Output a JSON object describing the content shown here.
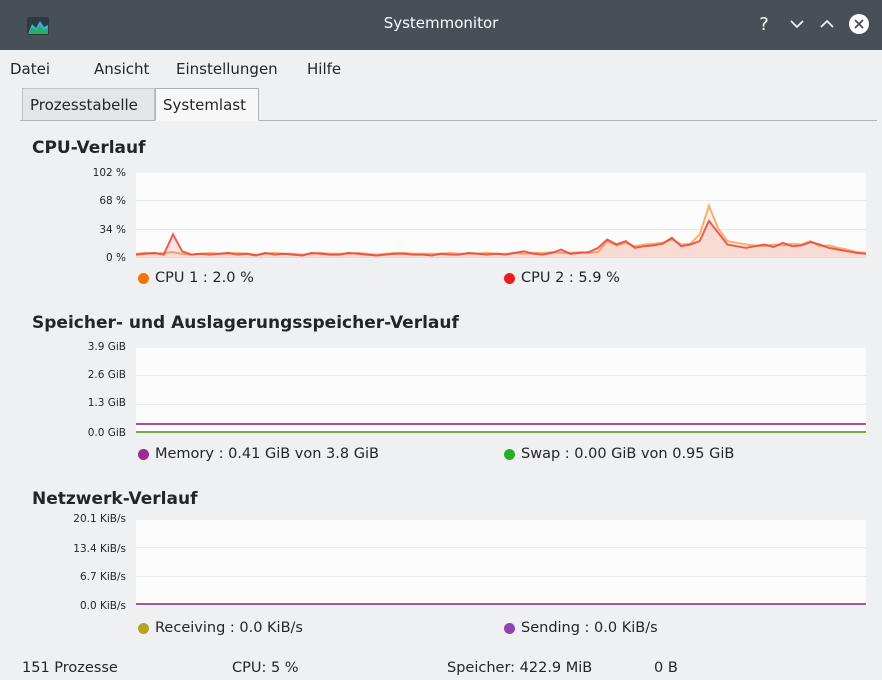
{
  "window": {
    "title": "Systemmonitor",
    "help": "?",
    "icon": "system-monitor-icon"
  },
  "menu": [
    "Datei",
    "Ansicht",
    "Einstellungen",
    "Hilfe"
  ],
  "tabs": [
    {
      "label": "Prozesstabelle",
      "active": false
    },
    {
      "label": "Systemlast",
      "active": true
    }
  ],
  "cpu": {
    "title": "CPU-Verlauf",
    "ticks": [
      "102 %",
      "68 %",
      "34 %",
      "0 %"
    ],
    "legend": [
      {
        "label": "CPU 1 : 2.0 %",
        "color": "#f67400"
      },
      {
        "label": "CPU 2 : 5.9 %",
        "color": "#e91e1e"
      }
    ]
  },
  "memory": {
    "title": "Speicher- und Auslagerungsspeicher-Verlauf",
    "ticks": [
      "3.9 GiB",
      "2.6 GiB",
      "1.3 GiB",
      "0.0 GiB"
    ],
    "legend": [
      {
        "label": "Memory : 0.41 GiB von 3.8 GiB",
        "color": "#9b2e8e"
      },
      {
        "label": "Swap : 0.00 GiB von 0.95 GiB",
        "color": "#27ae27"
      }
    ]
  },
  "network": {
    "title": "Netzwerk-Verlauf",
    "ticks": [
      "20.1 KiB/s",
      "13.4 KiB/s",
      "6.7 KiB/s",
      "0.0 KiB/s"
    ],
    "legend": [
      {
        "label": "Receiving : 0.0 KiB/s",
        "color": "#b6a12d"
      },
      {
        "label": "Sending : 0.0 KiB/s",
        "color": "#8e44ad"
      }
    ]
  },
  "status": {
    "processes": "151 Prozesse",
    "cpu": "CPU: 5 %",
    "memory": "Speicher: 422.9 MiB",
    "swap": "0 B"
  },
  "chart_data": [
    {
      "type": "line",
      "title": "CPU-Verlauf",
      "ylim": [
        0,
        102
      ],
      "series": [
        {
          "name": "CPU 1",
          "values": [
            5,
            6,
            5,
            6,
            7,
            5,
            4,
            5,
            6,
            5,
            5,
            6,
            5,
            4,
            5,
            6,
            5,
            5,
            4,
            5,
            6,
            5,
            5,
            5,
            6,
            5,
            4,
            5,
            6,
            6,
            5,
            5,
            5,
            5,
            6,
            5,
            5,
            5,
            6,
            5,
            5,
            6,
            5,
            6,
            6,
            7,
            6,
            6,
            7,
            6,
            7,
            20,
            15,
            18,
            14,
            16,
            17,
            18,
            22,
            16,
            17,
            28,
            62,
            35,
            20,
            18,
            16,
            15,
            14,
            16,
            15,
            17,
            16,
            20,
            14,
            15,
            12,
            10,
            7,
            6
          ]
        },
        {
          "name": "CPU 2",
          "values": [
            4,
            5,
            6,
            4,
            28,
            8,
            4,
            5,
            4,
            5,
            6,
            4,
            5,
            3,
            6,
            4,
            5,
            4,
            3,
            6,
            5,
            4,
            4,
            6,
            5,
            4,
            3,
            4,
            5,
            5,
            4,
            4,
            3,
            5,
            4,
            4,
            6,
            5,
            4,
            5,
            4,
            6,
            8,
            5,
            4,
            6,
            10,
            5,
            6,
            7,
            12,
            22,
            16,
            20,
            12,
            14,
            15,
            17,
            24,
            14,
            16,
            20,
            44,
            30,
            16,
            14,
            12,
            14,
            16,
            13,
            18,
            14,
            15,
            19,
            16,
            12,
            10,
            8,
            6,
            5
          ]
        }
      ]
    },
    {
      "type": "line",
      "title": "Speicher- und Auslagerungsspeicher-Verlauf",
      "ylim": [
        0,
        3.9
      ],
      "series": [
        {
          "name": "Memory",
          "values": [
            0.41,
            0.41
          ]
        },
        {
          "name": "Swap",
          "values": [
            0.0,
            0.0
          ]
        }
      ]
    },
    {
      "type": "line",
      "title": "Netzwerk-Verlauf",
      "ylim": [
        0,
        20.1
      ],
      "series": [
        {
          "name": "Receiving",
          "values": [
            0.0,
            0.0
          ]
        },
        {
          "name": "Sending",
          "values": [
            0.0,
            0.0
          ]
        }
      ]
    }
  ]
}
